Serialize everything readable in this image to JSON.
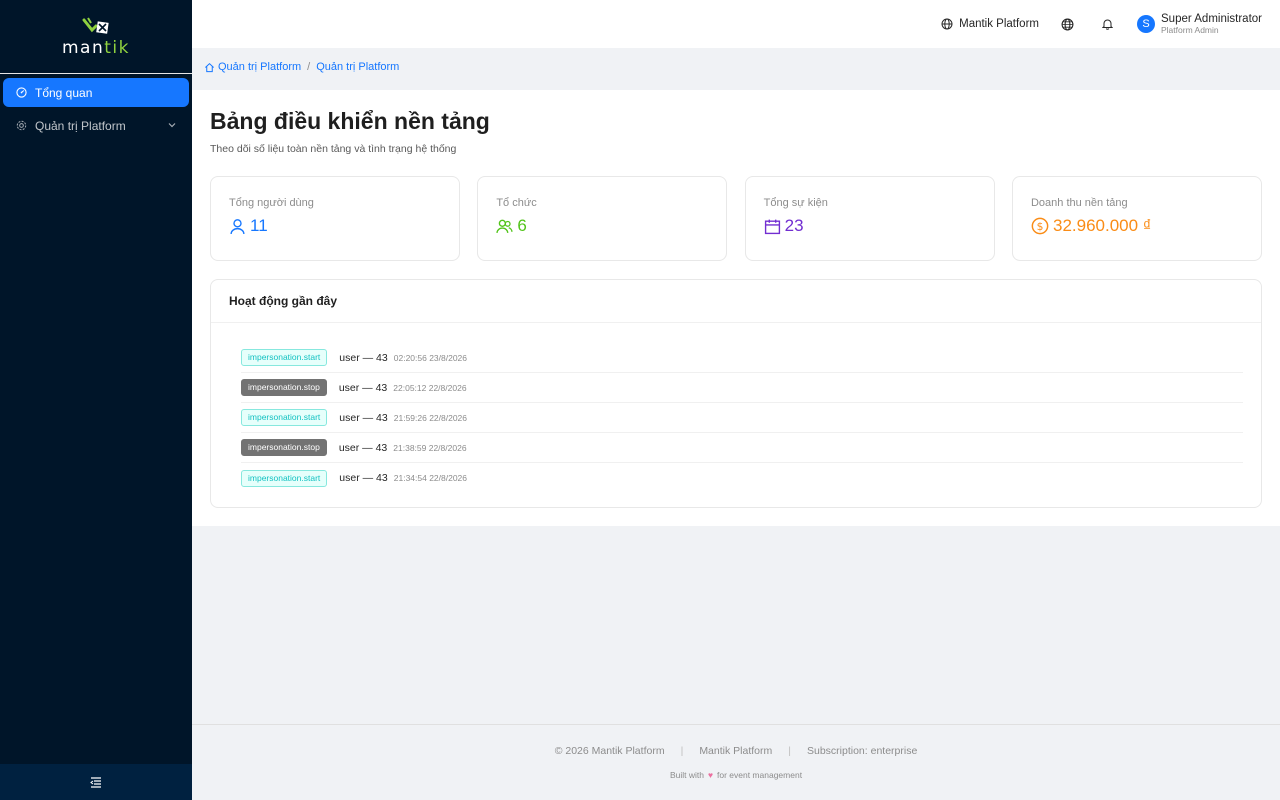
{
  "brand": {
    "name_main": "man",
    "name_accent": "tik"
  },
  "sidebar": {
    "items": [
      {
        "label": "Tổng quan",
        "active": true
      },
      {
        "label": "Quản trị Platform",
        "active": false
      }
    ]
  },
  "header": {
    "platform_label": "Mantik Platform",
    "user": {
      "initial": "S",
      "name": "Super Administrator",
      "role": "Platform Admin"
    }
  },
  "breadcrumb": [
    "Quản trị Platform",
    "Quản trị Platform"
  ],
  "page": {
    "title": "Bảng điều khiển nền tảng",
    "subtitle": "Theo dõi số liệu toàn nền tảng và tình trạng hệ thống"
  },
  "stats": [
    {
      "label": "Tổng người dùng",
      "value": "11",
      "color": "#1677ff",
      "icon": "user-icon"
    },
    {
      "label": "Tổ chức",
      "value": "6",
      "color": "#52c41a",
      "icon": "team-icon"
    },
    {
      "label": "Tổng sự kiện",
      "value": "23",
      "color": "#722ed1",
      "icon": "calendar-icon"
    },
    {
      "label": "Doanh thu nền tảng",
      "value": "32.960.000 ₫",
      "color": "#fa8c16",
      "icon": "dollar-icon"
    }
  ],
  "activity": {
    "title": "Hoạt động gần đây",
    "rows": [
      {
        "tag": "impersonation.start",
        "text": "user — 43",
        "time": "02:20:56 23/8/2026"
      },
      {
        "tag": "impersonation.stop",
        "text": "user — 43",
        "time": "22:05:12 22/8/2026"
      },
      {
        "tag": "impersonation.start",
        "text": "user — 43",
        "time": "21:59:26 22/8/2026"
      },
      {
        "tag": "impersonation.stop",
        "text": "user — 43",
        "time": "21:38:59 22/8/2026"
      },
      {
        "tag": "impersonation.start",
        "text": "user — 43",
        "time": "21:34:54 22/8/2026"
      }
    ]
  },
  "footer": {
    "copyright": "© 2026 Mantik Platform",
    "product": "Mantik Platform",
    "subscription": "Subscription: enterprise",
    "made_prefix": "Built with",
    "made_suffix": "for event management"
  }
}
